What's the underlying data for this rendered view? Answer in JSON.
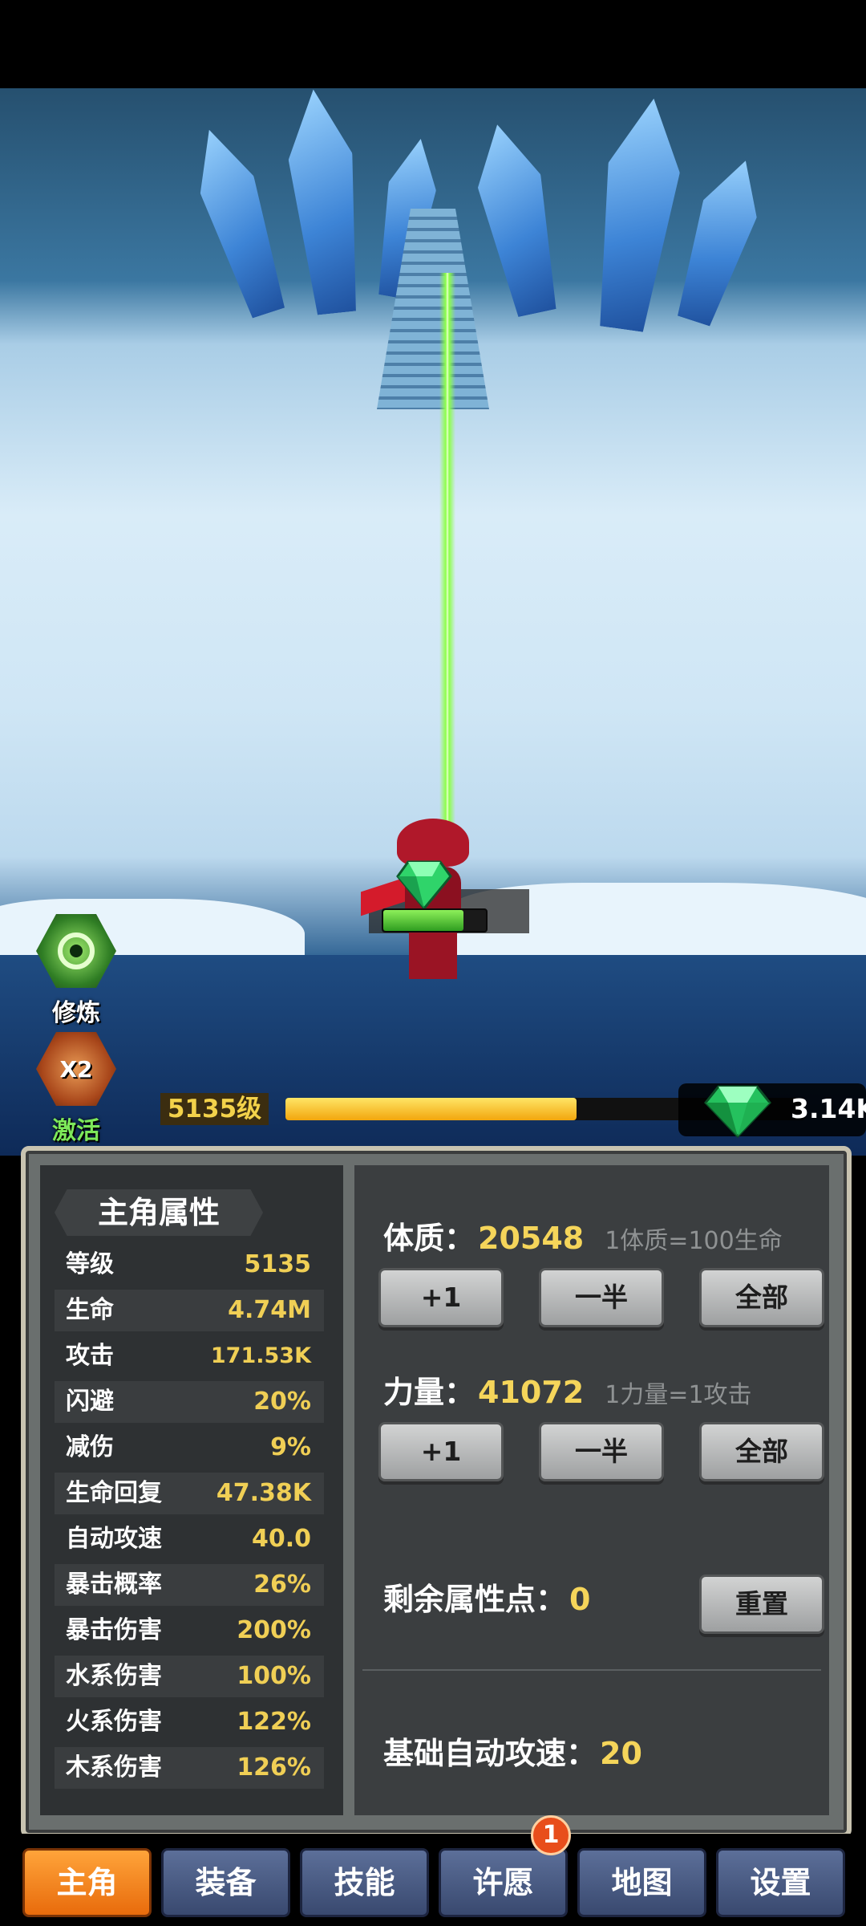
{
  "side_buttons": {
    "cultivate": {
      "label": "修炼",
      "icon": "green-swirl-icon"
    },
    "activate": {
      "label": "激活",
      "icon": "x2-bag-icon",
      "multiplier": "X2"
    }
  },
  "level": {
    "label": "5135级",
    "xp_progress": 0.56
  },
  "currency": {
    "icon": "green-gem-icon",
    "amount": "3.14K"
  },
  "stats_panel": {
    "title": "主角属性",
    "rows": [
      {
        "name": "等级",
        "value": "5135"
      },
      {
        "name": "生命",
        "value": "4.74M"
      },
      {
        "name": "攻击",
        "value": "171.53K"
      },
      {
        "name": "闪避",
        "value": "20%"
      },
      {
        "name": "减伤",
        "value": "9%"
      },
      {
        "name": "生命回复",
        "value": "47.38K"
      },
      {
        "name": "自动攻速",
        "value": "40.0"
      },
      {
        "name": "暴击概率",
        "value": "26%"
      },
      {
        "name": "暴击伤害",
        "value": "200%"
      },
      {
        "name": "水系伤害",
        "value": "100%"
      },
      {
        "name": "火系伤害",
        "value": "122%"
      },
      {
        "name": "木系伤害",
        "value": "126%"
      }
    ]
  },
  "attributes": {
    "constitution": {
      "label": "体质：",
      "value": "20548",
      "note": "1体质=100生命"
    },
    "strength": {
      "label": "力量：",
      "value": "41072",
      "note": "1力量=1攻击"
    },
    "buttons": {
      "plus_one": "+1",
      "half": "一半",
      "all": "全部"
    },
    "remaining": {
      "label": "剩余属性点：",
      "value": "0"
    },
    "reset_label": "重置",
    "base_speed": {
      "label": "基础自动攻速：",
      "value": "20"
    }
  },
  "hero": {
    "hp_progress": 0.78
  },
  "nav": {
    "items": [
      "主角",
      "装备",
      "技能",
      "许愿",
      "地图",
      "设置"
    ],
    "active": "主角",
    "badge_count": "1"
  }
}
